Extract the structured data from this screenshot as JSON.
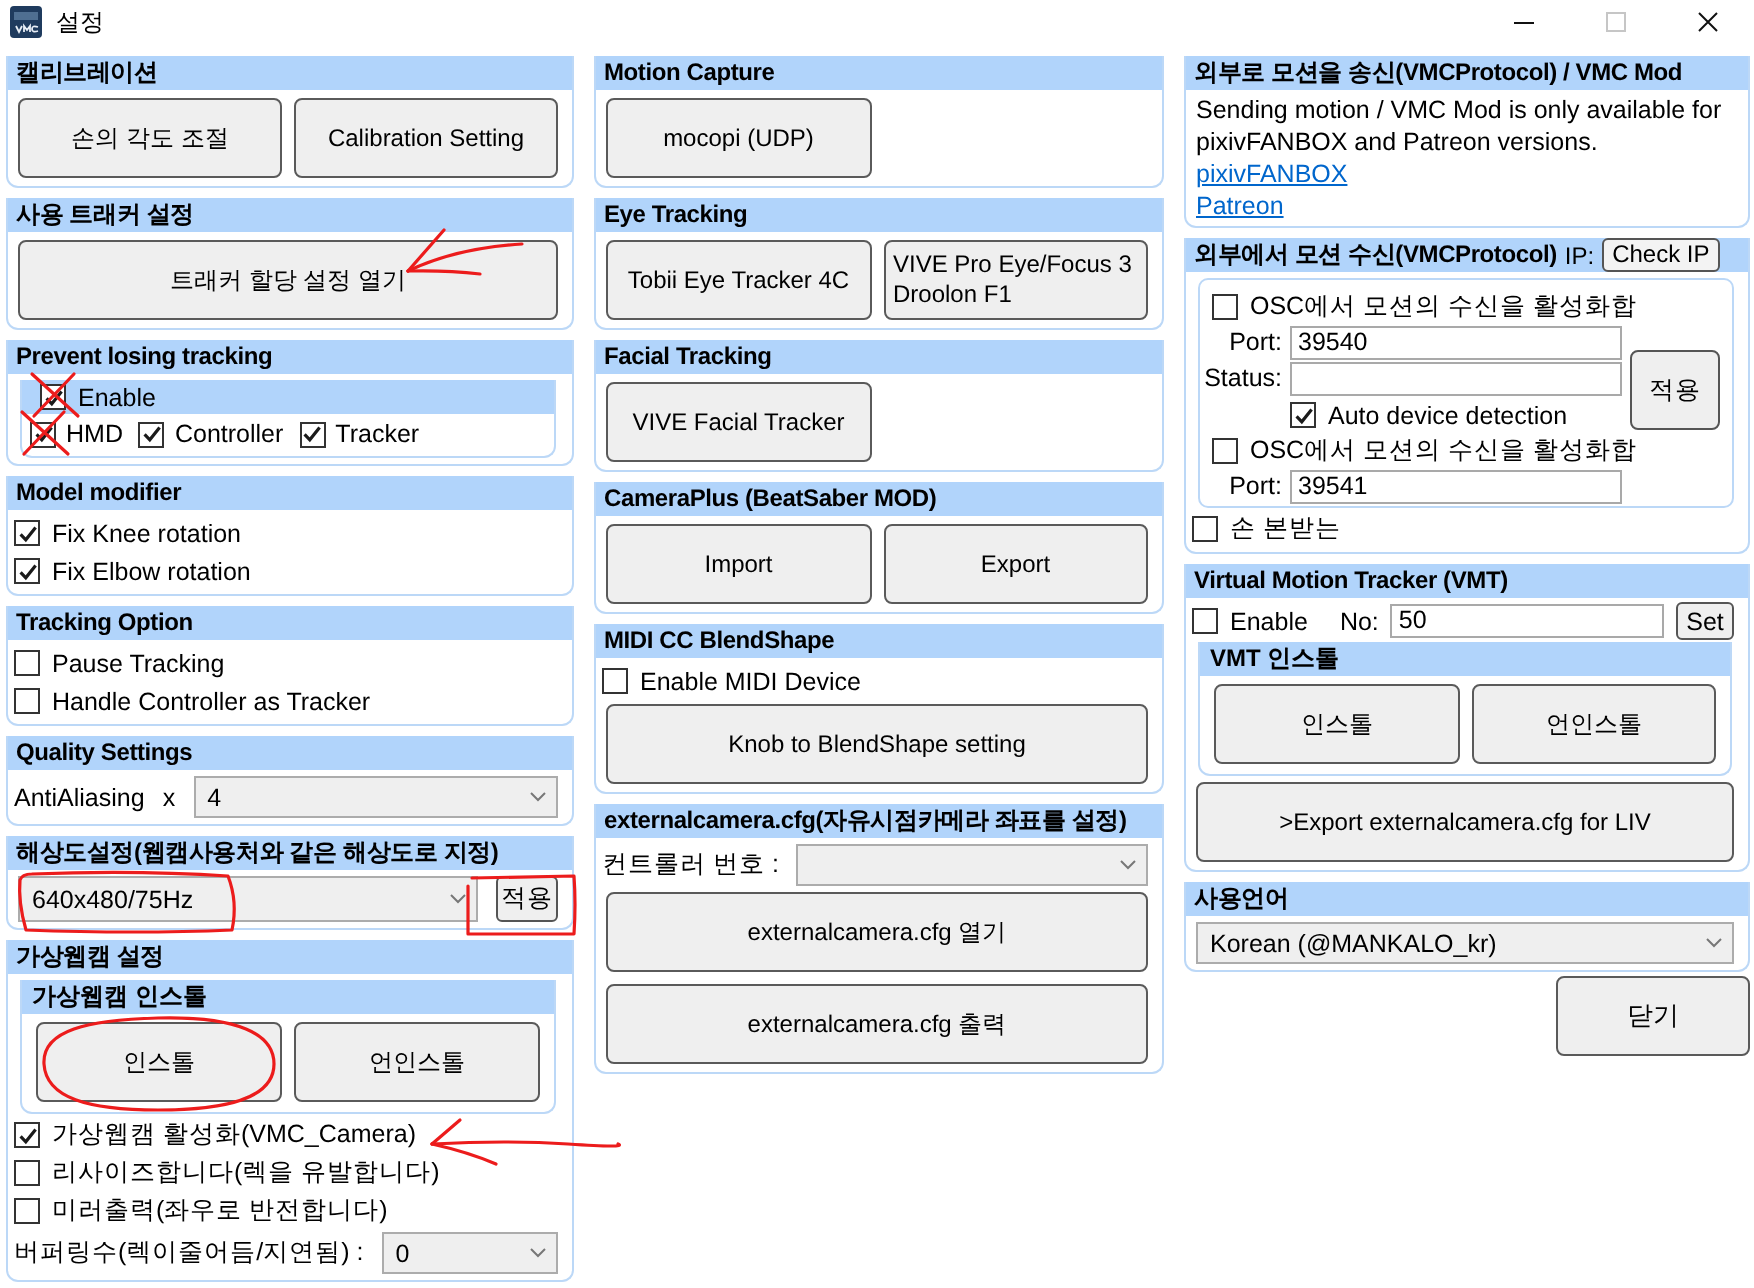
{
  "window": {
    "title": "설정",
    "controls": [
      {
        "kind": "minimize",
        "disabled": false
      },
      {
        "kind": "maximize",
        "disabled": true
      },
      {
        "kind": "close",
        "disabled": false
      }
    ]
  },
  "columns": [
    {
      "groups": [
        {
          "title": "캘리브레이션",
          "items": [
            {
              "kind": "buttons",
              "buttons": [
                {
                  "label": "손의 각도 조절",
                  "kind": "regular"
                },
                {
                  "label": "Calibration Setting",
                  "kind": "regular"
                }
              ]
            }
          ]
        },
        {
          "title": "사용 트래커 설정",
          "items": [
            {
              "kind": "buttons",
              "buttons": [
                {
                  "label": "트래커 할당 설정 열기",
                  "kind": "wide",
                  "annotation": {
                    "kind": "arrow"
                  }
                }
              ]
            }
          ]
        },
        {
          "title": "Prevent losing tracking",
          "items": [
            {
              "kind": "subgroup",
              "header_checkbox": {
                "label": "Enable",
                "checked": true,
                "annotation": {
                  "kind": "cross"
                }
              },
              "items": [
                {
                  "kind": "checkbox_row",
                  "checkboxes": [
                    {
                      "label": "HMD",
                      "checked": true,
                      "annotation": {
                        "kind": "cross"
                      }
                    },
                    {
                      "label": "Controller",
                      "checked": true
                    },
                    {
                      "label": "Tracker",
                      "checked": true
                    }
                  ]
                }
              ]
            }
          ]
        },
        {
          "title": "Model modifier",
          "items": [
            {
              "kind": "checkbox",
              "label": "Fix Knee rotation",
              "checked": true
            },
            {
              "kind": "checkbox",
              "label": "Fix Elbow rotation",
              "checked": true
            }
          ]
        },
        {
          "title": "Tracking Option",
          "items": [
            {
              "kind": "checkbox",
              "label": "Pause Tracking",
              "checked": false
            },
            {
              "kind": "checkbox",
              "label": "Handle Controller as Tracker",
              "checked": false
            }
          ]
        },
        {
          "title": "Quality Settings",
          "items": [
            {
              "kind": "select",
              "label": "AntiAliasing",
              "prefix": "x",
              "value": "4"
            }
          ]
        },
        {
          "title": "해상도설정(웹캠사용처와 같은 해상도로 지정)",
          "items": [
            {
              "kind": "select",
              "value": "640x480/75Hz",
              "annotation": {
                "kind": "circle"
              },
              "button": {
                "label": "적용",
                "annotation": {
                  "kind": "box"
                }
              }
            }
          ]
        },
        {
          "title": "가상웹캠 설정",
          "items": [
            {
              "kind": "subgroup",
              "title": "가상웹캠 인스톨",
              "items": [
                {
                  "kind": "buttons",
                  "buttons": [
                    {
                      "label": "인스톨",
                      "kind": "regular",
                      "annotation": {
                        "kind": "circle"
                      }
                    },
                    {
                      "label": "언인스톨",
                      "kind": "regular"
                    }
                  ]
                }
              ]
            },
            {
              "kind": "checkbox",
              "label": "가상웹캠 활성화(VMC_Camera)",
              "checked": true,
              "annotation": {
                "kind": "arrow"
              }
            },
            {
              "kind": "checkbox",
              "label": "리사이즈합니다(렉을 유발합니다)",
              "checked": false
            },
            {
              "kind": "checkbox",
              "label": "미러출력(좌우로 반전합니다)",
              "checked": false
            },
            {
              "kind": "select",
              "label": "버퍼링수(렉이줄어듬/지연됨) :",
              "value": "0"
            }
          ]
        }
      ]
    },
    {
      "groups": [
        {
          "title": "Motion Capture",
          "items": [
            {
              "kind": "buttons",
              "buttons": [
                {
                  "label": "mocopi (UDP)",
                  "kind": "regular"
                }
              ]
            }
          ]
        },
        {
          "title": "Eye Tracking",
          "items": [
            {
              "kind": "buttons",
              "buttons": [
                {
                  "label": "Tobii Eye Tracker 4C",
                  "kind": "regular"
                },
                {
                  "label": "VIVE Pro Eye/Focus 3 Droolon F1",
                  "kind": "regular"
                }
              ]
            }
          ]
        },
        {
          "title": "Facial Tracking",
          "items": [
            {
              "kind": "buttons",
              "buttons": [
                {
                  "label": "VIVE Facial Tracker",
                  "kind": "regular"
                }
              ]
            }
          ]
        },
        {
          "title": "CameraPlus (BeatSaber MOD)",
          "items": [
            {
              "kind": "buttons",
              "buttons": [
                {
                  "label": "Import",
                  "kind": "regular"
                },
                {
                  "label": "Export",
                  "kind": "regular"
                }
              ]
            }
          ]
        },
        {
          "title": "MIDI CC BlendShape",
          "items": [
            {
              "kind": "checkbox",
              "label": "Enable MIDI Device",
              "checked": false
            },
            {
              "kind": "buttons",
              "buttons": [
                {
                  "label": "Knob to BlendShape setting",
                  "kind": "wide"
                }
              ]
            }
          ]
        },
        {
          "title": "externalcamera.cfg(자유시점카메라 좌표를 설정)",
          "items": [
            {
              "kind": "select",
              "label": "컨트롤러 번호 :"
            },
            {
              "kind": "buttons",
              "buttons": [
                {
                  "label": "externalcamera.cfg 열기",
                  "kind": "wide"
                }
              ]
            },
            {
              "kind": "buttons",
              "buttons": [
                {
                  "label": "externalcamera.cfg 출력",
                  "kind": "wide"
                }
              ]
            }
          ]
        }
      ]
    },
    {
      "groups": [
        {
          "title": "외부로 모션을 송신(VMCProtocol) / VMC Mod",
          "items": [
            {
              "kind": "text",
              "text": "Sending motion / VMC Mod is only available for pixivFANBOX and Patreon versions."
            },
            {
              "kind": "link",
              "text": "pixivFANBOX"
            },
            {
              "kind": "link",
              "text": "Patreon"
            }
          ]
        },
        {
          "title": "외부에서 모션 수신(VMCProtocol)",
          "header_label": "IP:",
          "header_button": "Check IP",
          "items": [
            {
              "kind": "osc_panel",
              "receivers": [
                {
                  "checkbox": {
                    "label": "OSC에서 모션의 수신을 활성화합",
                    "checked": false
                  },
                  "fields": [
                    {
                      "label": "Port:",
                      "value": "39540"
                    },
                    {
                      "label": "Status:"
                    }
                  ],
                  "option": {
                    "label": "Auto device detection",
                    "checked": true
                  }
                },
                {
                  "checkbox": {
                    "label": "OSC에서 모션의 수신을 활성화합",
                    "checked": false
                  },
                  "fields": [
                    {
                      "label": "Port:",
                      "value": "39541"
                    }
                  ]
                }
              ],
              "apply_button": "적용"
            },
            {
              "kind": "checkbox",
              "label": "손 본받는",
              "checked": false
            }
          ]
        },
        {
          "title": "Virtual Motion Tracker (VMT)",
          "items": [
            {
              "kind": "field_row",
              "checkbox": {
                "label": "Enable",
                "checked": false
              },
              "field": {
                "label": "No:",
                "value": "50"
              },
              "button": "Set"
            },
            {
              "kind": "subgroup",
              "title": "VMT 인스톨",
              "items": [
                {
                  "kind": "buttons",
                  "buttons": [
                    {
                      "label": "인스톨",
                      "kind": "regular"
                    },
                    {
                      "label": "언인스톨",
                      "kind": "regular"
                    }
                  ]
                }
              ]
            },
            {
              "kind": "buttons",
              "buttons": [
                {
                  "label": ">Export externalcamera.cfg for LIV",
                  "kind": "wide"
                }
              ]
            }
          ]
        },
        {
          "title": "사용언어",
          "items": [
            {
              "kind": "select",
              "value": "Korean (@MANKALO_kr)"
            }
          ]
        }
      ],
      "footer_button": "닫기"
    }
  ]
}
